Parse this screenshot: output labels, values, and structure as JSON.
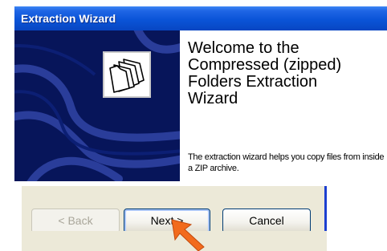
{
  "window": {
    "title": "Extraction Wizard"
  },
  "welcome": {
    "heading": "Welcome to the\nCompressed (zipped)\nFolders Extraction\nWizard",
    "body": "The extraction wizard helps you copy files from inside a ZIP archive."
  },
  "buttons": {
    "back_label": "< Back",
    "next_label": "Next >",
    "cancel_label": "Cancel"
  },
  "colors": {
    "title_bar": "#0a54d8",
    "side_panel": "#07155a",
    "dialog_face": "#ece9d8",
    "pointer_arrow": "#f26b1d"
  },
  "icons": {
    "side_panel": "zipped-folders-icon",
    "pointer": "arrow-pointer-icon"
  }
}
